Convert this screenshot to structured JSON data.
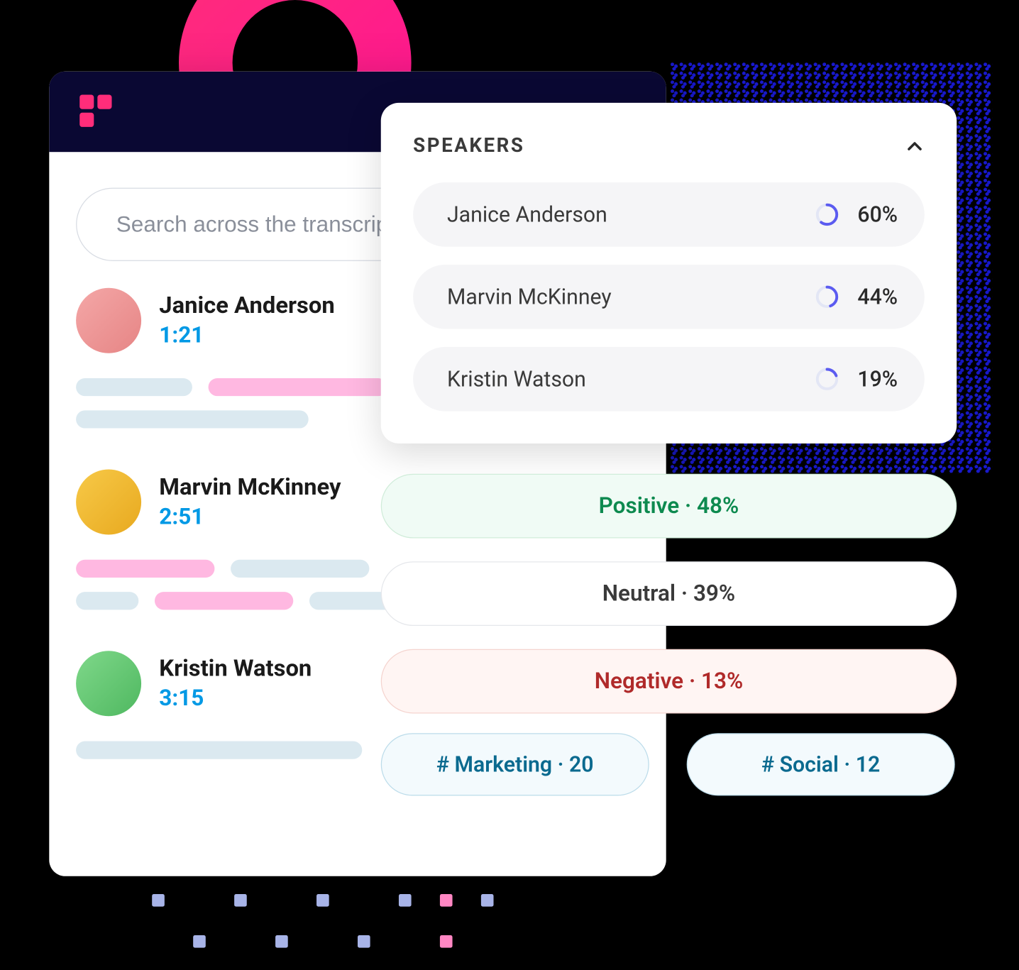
{
  "search": {
    "placeholder": "Search across the transcript"
  },
  "transcript": [
    {
      "name": "Janice Anderson",
      "time": "1:21",
      "avatar_bg": "linear-gradient(135deg,#f4a7a7,#e68585)"
    },
    {
      "name": "Marvin McKinney",
      "time": "2:51",
      "avatar_bg": "linear-gradient(135deg,#f7c948,#e8a91f)"
    },
    {
      "name": "Kristin Watson",
      "time": "3:15",
      "avatar_bg": "linear-gradient(135deg,#7fd88a,#4fb860)"
    }
  ],
  "speakers_panel": {
    "title": "SPEAKERS",
    "items": [
      {
        "name": "Janice Anderson",
        "pct_label": "60%",
        "pct": 60
      },
      {
        "name": "Marvin McKinney",
        "pct_label": "44%",
        "pct": 44
      },
      {
        "name": "Kristin Watson",
        "pct_label": "19%",
        "pct": 19
      }
    ]
  },
  "sentiment": {
    "positive": "Positive · 48%",
    "neutral": "Neutral · 39%",
    "negative": "Negative · 13%"
  },
  "tags": [
    {
      "label": "# Marketing · 20"
    },
    {
      "label": "# Social · 12"
    }
  ]
}
